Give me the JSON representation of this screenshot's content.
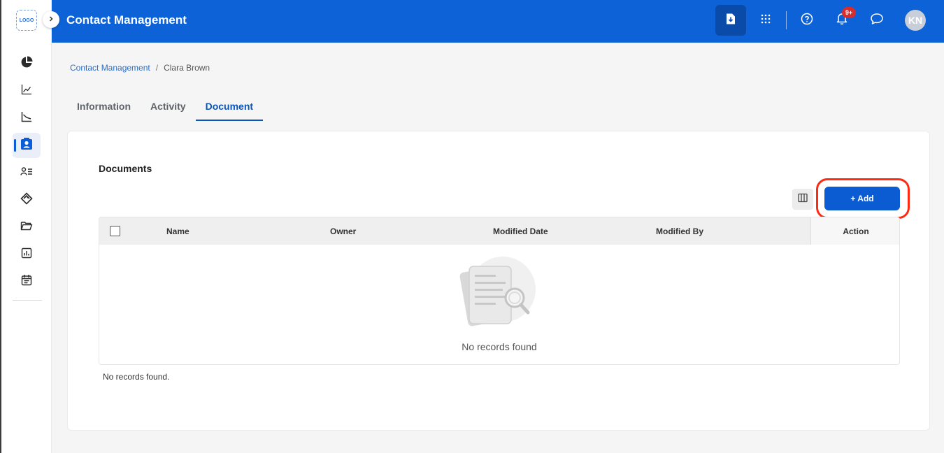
{
  "sidebar": {
    "logo_text": "LOGO",
    "items": [
      {
        "icon": "pie-chart-icon"
      },
      {
        "icon": "line-chart-icon"
      },
      {
        "icon": "trend-chart-icon"
      },
      {
        "icon": "contact-card-icon",
        "active": true
      },
      {
        "icon": "user-list-icon"
      },
      {
        "icon": "tag-icon"
      },
      {
        "icon": "folder-icon"
      },
      {
        "icon": "report-icon"
      },
      {
        "icon": "calendar-icon"
      }
    ]
  },
  "header": {
    "title": "Contact Management",
    "notification_badge": "9+",
    "avatar_initials": "KN",
    "icons": [
      "download-file-icon",
      "apps-grid-icon",
      "help-icon",
      "bell-icon",
      "chat-icon"
    ]
  },
  "breadcrumb": {
    "root": "Contact Management",
    "separator": "/",
    "current": "Clara Brown"
  },
  "tabs": [
    {
      "label": "Information"
    },
    {
      "label": "Activity"
    },
    {
      "label": "Document",
      "active": true
    }
  ],
  "documents": {
    "title": "Documents",
    "add_label": "+ Add",
    "columns": [
      "Name",
      "Owner",
      "Modified Date",
      "Modified By",
      "Action"
    ],
    "empty_message": "No records found",
    "footer_message": "No records found."
  },
  "colors": {
    "header_bg": "#0c62d6",
    "primary": "#0b5bd3",
    "highlight": "#ff2a12",
    "badge": "#d92c2c"
  }
}
